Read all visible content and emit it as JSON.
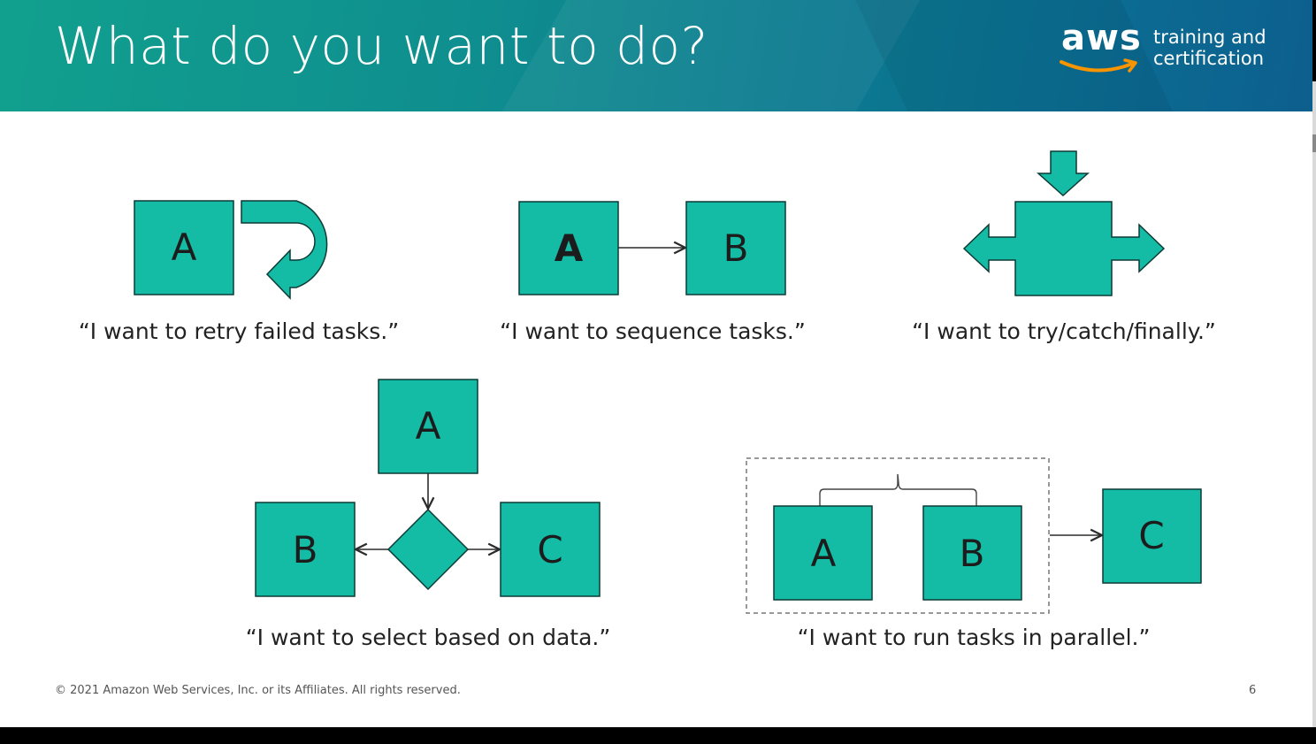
{
  "slide": {
    "title": "What do you want to do?",
    "logo": {
      "wordmark": "aws",
      "line1": "training and",
      "line2": "certification"
    },
    "footer": "© 2021 Amazon Web Services, Inc. or its Affiliates. All rights reserved.",
    "page_number": "6"
  },
  "colors": {
    "box_fill": "#14bba5",
    "box_stroke": "#0d3b36",
    "header_start": "#11a08e",
    "header_end": "#0d5f8e"
  },
  "patterns": {
    "retry": {
      "box": "A",
      "icon": "retry-arrow-icon",
      "caption": "“I want to retry failed tasks.”"
    },
    "sequence": {
      "box_a": "A",
      "box_b": "B",
      "caption": "“I want to sequence tasks.”"
    },
    "try_catch": {
      "icon": "try-catch-arrows-icon",
      "caption": "“I want to try/catch/finally.”"
    },
    "choice": {
      "box_a": "A",
      "box_b": "B",
      "box_c": "C",
      "caption": "“I want to select based on data.”"
    },
    "parallel": {
      "box_a": "A",
      "box_b": "B",
      "box_c": "C",
      "caption": "“I want to run tasks in parallel.”"
    }
  }
}
